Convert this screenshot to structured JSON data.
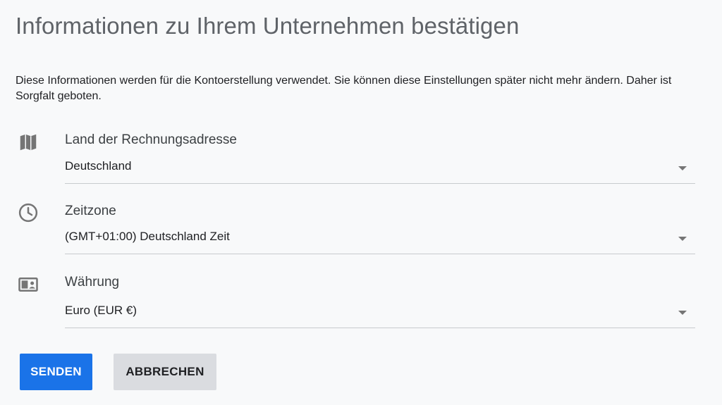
{
  "page": {
    "title": "Informationen zu Ihrem Unternehmen bestätigen",
    "description": "Diese Informationen werden für die Kontoerstellung verwendet. Sie können diese Einstellungen später nicht mehr ändern. Daher ist Sorgfalt geboten."
  },
  "fields": {
    "country": {
      "label": "Land der Rechnungsadresse",
      "value": "Deutschland",
      "icon": "map-icon"
    },
    "timezone": {
      "label": "Zeitzone",
      "value": "(GMT+01:00) Deutschland Zeit",
      "icon": "clock-icon"
    },
    "currency": {
      "label": "Währung",
      "value": "Euro (EUR €)",
      "icon": "currency-icon"
    }
  },
  "actions": {
    "submit_label": "SENDEN",
    "cancel_label": "ABBRECHEN"
  },
  "colors": {
    "primary": "#1a73e8",
    "secondary_button": "#dadce0",
    "icon": "#757575",
    "background": "#f8f9fa"
  }
}
